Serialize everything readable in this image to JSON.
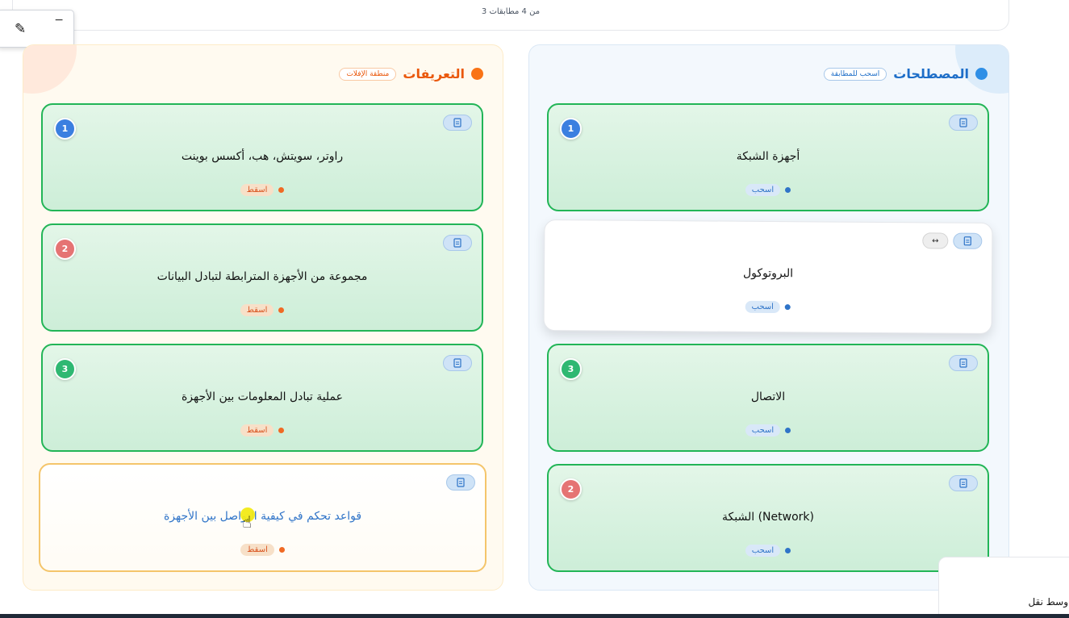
{
  "top": {
    "match_count": "3 من 4 مطابقات"
  },
  "definitions": {
    "title": "التعريفات",
    "badge": "منطقة الإفلات",
    "cards": [
      {
        "number": "1",
        "text": "راوتر، سويتش، هب، أكسس بوينت",
        "tag": "اسقط"
      },
      {
        "number": "2",
        "text": "مجموعة من الأجهزة المترابطة لتبادل البيانات",
        "tag": "اسقط"
      },
      {
        "number": "3",
        "text": "عملية تبادل المعلومات بين الأجهزة",
        "tag": "اسقط"
      },
      {
        "number": "",
        "text": "قواعد تحكم في كيفية التواصل بين الأجهزة",
        "tag": "اسقط"
      }
    ]
  },
  "terms": {
    "title": "المصطلحات",
    "badge": "اسحب للمطابقة",
    "cards": [
      {
        "number": "1",
        "text": "أجهزة الشبكة",
        "tag": "اسحب"
      },
      {
        "number": "",
        "text": "البروتوكول",
        "tag": "اسحب"
      },
      {
        "number": "3",
        "text": "الاتصال",
        "tag": "اسحب"
      },
      {
        "number": "2",
        "text": "الشبكة (Network)",
        "tag": "اسحب"
      }
    ]
  },
  "side_label": "وسط نقل",
  "icons": {
    "doc": "document-icon",
    "move": "move-icon",
    "pen": "pen-icon"
  },
  "colors": {
    "match_green": "#22b557",
    "accent_orange": "#ea580c",
    "accent_blue": "#1e6ec8"
  }
}
